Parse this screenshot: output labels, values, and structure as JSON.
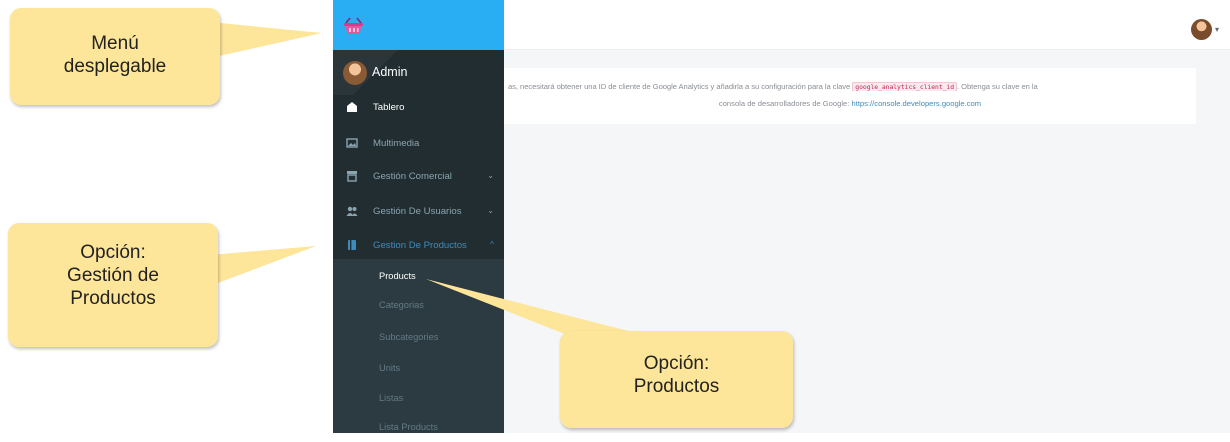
{
  "header": {
    "brand_icon": "basket-logo-icon",
    "user_avatar_icon": "user-avatar-icon",
    "user_menu_caret": "▾"
  },
  "notice": {
    "line1_prefix": "as, necesitará obtener una ID de cliente de Google Analytics y añadirla a su configuración para la clave",
    "line1_code": "google_analytics_client_id",
    "line1_suffix": ". Obtenga su clave en la",
    "line2_prefix": "consola de desarrolladores de Google:",
    "line2_link": "https://console.developers.google.com"
  },
  "sidebar": {
    "user_name": "Admin",
    "items": [
      {
        "label": "Tablero",
        "icon": "dashboard-icon",
        "chevron": ""
      },
      {
        "label": "Multimedia",
        "icon": "image-icon",
        "chevron": ""
      },
      {
        "label": "Gestión Comercial",
        "icon": "store-icon",
        "chevron": "⌄"
      },
      {
        "label": "Gestión De Usuarios",
        "icon": "users-icon",
        "chevron": "⌄"
      },
      {
        "label": "Gestion De Productos",
        "icon": "book-icon",
        "chevron": "^"
      }
    ],
    "submenu": [
      {
        "label": "Products"
      },
      {
        "label": "Categorias"
      },
      {
        "label": "Subcategories"
      },
      {
        "label": "Units"
      },
      {
        "label": "Listas"
      },
      {
        "label": "Lista Products"
      }
    ]
  },
  "callouts": {
    "menu_line1": "Menú",
    "menu_line2": "desplegable",
    "option_products_mgmt_line1": "Opción:",
    "option_products_mgmt_line2": "Gestión de",
    "option_products_mgmt_line3": "Productos",
    "option_products_line1": "Opción:",
    "option_products_line2": "Productos"
  },
  "colors": {
    "brand_bar": "#29aef4",
    "sidebar_bg": "#222d32",
    "submenu_bg": "#2c3b41",
    "accent": "#3c8dbc",
    "callout_bg": "#fde59a"
  }
}
